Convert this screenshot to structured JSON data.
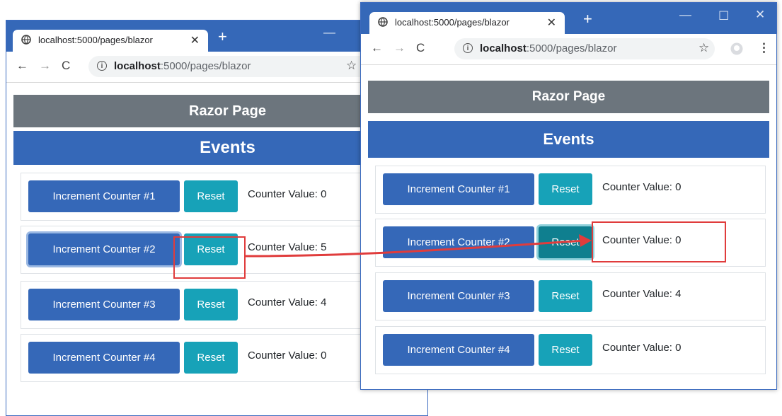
{
  "browser_left": {
    "tab_title": "localhost:5000/pages/blazor",
    "url_host": "localhost",
    "url_rest": ":5000/pages/blazor"
  },
  "browser_right": {
    "tab_title": "localhost:5000/pages/blazor",
    "url_host": "localhost",
    "url_rest": ":5000/pages/blazor"
  },
  "page": {
    "razor_heading": "Razor Page",
    "events_heading": "Events",
    "reset_label": "Reset"
  },
  "left_rows": [
    {
      "button": "Increment Counter #1",
      "value": "Counter Value: 0"
    },
    {
      "button": "Increment Counter #2",
      "value": "Counter Value: 5"
    },
    {
      "button": "Increment Counter #3",
      "value": "Counter Value: 4"
    },
    {
      "button": "Increment Counter #4",
      "value": "Counter Value: 0"
    }
  ],
  "right_rows": [
    {
      "button": "Increment Counter #1",
      "value": "Counter Value: 0"
    },
    {
      "button": "Increment Counter #2",
      "value": "Counter Value: 0"
    },
    {
      "button": "Increment Counter #3",
      "value": "Counter Value: 4"
    },
    {
      "button": "Increment Counter #4",
      "value": "Counter Value: 0"
    }
  ],
  "colors": {
    "primary": "#3568b8",
    "info": "#17a2b8",
    "secondary": "#6c757d",
    "annotation": "#e03c3c"
  },
  "icons": [
    "globe-icon",
    "close-icon",
    "plus-icon",
    "back-icon",
    "forward-icon",
    "reload-icon",
    "info-icon",
    "star-icon",
    "profile-icon",
    "menu-icon",
    "minimize-icon",
    "maximize-icon"
  ]
}
